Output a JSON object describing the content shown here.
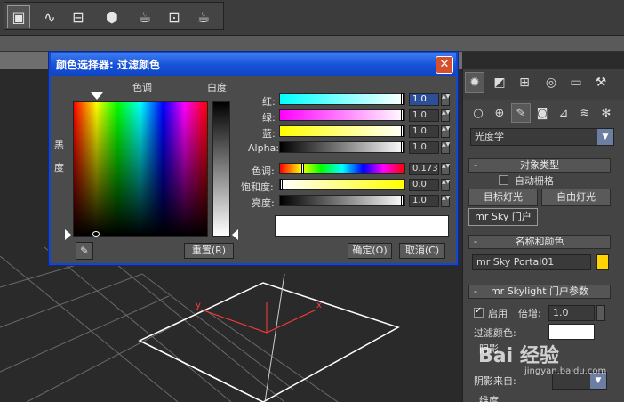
{
  "toolbar": {
    "icons": [
      "scene-explorer-icon",
      "curve-editor-icon",
      "schematic-view-icon",
      "material-editor-icon",
      "render-setup-icon",
      "rendered-frame-icon",
      "render-icon"
    ]
  },
  "dialog": {
    "title": "颜色选择器: 过滤颜色",
    "close_label": "✕",
    "hue_label": "色调",
    "whiteness_label": "白度",
    "blackness_label_1": "黑",
    "blackness_label_2": "度",
    "channels": [
      {
        "label": "红:",
        "value": "1.0"
      },
      {
        "label": "绿:",
        "value": "1.0"
      },
      {
        "label": "蓝:",
        "value": "1.0"
      },
      {
        "label": "Alpha:",
        "value": "1.0"
      }
    ],
    "hsv": [
      {
        "label": "色调:",
        "value": "0.173"
      },
      {
        "label": "饱和度:",
        "value": "0.0"
      },
      {
        "label": "亮度:",
        "value": "1.0"
      }
    ],
    "reset_label": "重置(R)",
    "ok_label": "确定(O)",
    "cancel_label": "取消(C)",
    "preview_color": "#ffffff"
  },
  "command_panel": {
    "dropdown_value": "光度学",
    "object_type": {
      "title": "对象类型",
      "autogrid_label": "自动栅格",
      "buttons": [
        "目标灯光",
        "自由灯光",
        "mr Sky 门户"
      ]
    },
    "name_color": {
      "title": "名称和颜色",
      "name_value": "mr Sky Portal01",
      "swatch_color": "#ffd400"
    },
    "params": {
      "title": "mr Skylight 门户参数",
      "enable_label": "启用",
      "multiplier_label": "倍增:",
      "multiplier_value": "1.0",
      "filter_color_label": "过滤颜色:",
      "filter_swatch": "#ffffff",
      "shadow_label": "阴影",
      "shadow_from_label": "阴影来自:",
      "dimension_label": "维度"
    }
  },
  "watermark": "Bai 经验",
  "watermark_url": "jingyan.baidu.com"
}
